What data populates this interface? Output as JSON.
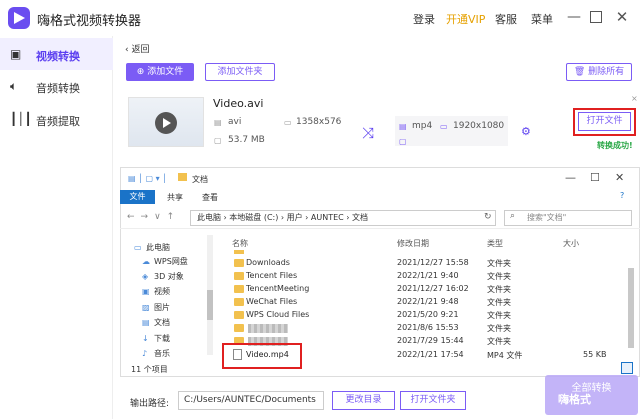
{
  "app": {
    "title": "嗨格式视频转换器"
  },
  "header": {
    "login": "登录",
    "vip": "开通VIP",
    "service": "客服",
    "menu": "菜单"
  },
  "sidebar": {
    "items": [
      {
        "label": "视频转换"
      },
      {
        "label": "音频转换"
      },
      {
        "label": "音频提取"
      }
    ]
  },
  "toolbar": {
    "back": "返回",
    "add_file": "⊕ 添加文件",
    "add_folder": "添加文件夹",
    "delete_all": "删除所有"
  },
  "file": {
    "name": "Video.avi",
    "src_format": "avi",
    "src_resolution": "1358x576",
    "src_size": "53.7 MB",
    "out_format": "mp4",
    "out_resolution": "1920x1080",
    "open_folder": "打开文件",
    "status": "转换成功!"
  },
  "explorer": {
    "title": "文档",
    "ribbon": {
      "file": "文件",
      "share": "共享",
      "view": "查看"
    },
    "address": "此电脑 › 本地磁盘 (C:) › 用户 › AUNTEC › 文档",
    "search_placeholder": "搜索\"文档\"",
    "nav": [
      {
        "label": "此电脑"
      },
      {
        "label": "WPS网盘"
      },
      {
        "label": "3D 对象"
      },
      {
        "label": "视频"
      },
      {
        "label": "图片"
      },
      {
        "label": "文档"
      },
      {
        "label": "下载"
      },
      {
        "label": "音乐"
      }
    ],
    "columns": {
      "name": "名称",
      "modified": "修改日期",
      "type": "类型",
      "size": "大小"
    },
    "rows": [
      {
        "name": "Downloads",
        "modified": "2021/12/27 15:58",
        "type": "文件夹",
        "size": ""
      },
      {
        "name": "Tencent Files",
        "modified": "2022/1/21 9:40",
        "type": "文件夹",
        "size": ""
      },
      {
        "name": "TencentMeeting",
        "modified": "2021/12/27 16:02",
        "type": "文件夹",
        "size": ""
      },
      {
        "name": "WeChat Files",
        "modified": "2022/1/21 9:48",
        "type": "文件夹",
        "size": ""
      },
      {
        "name": "WPS Cloud Files",
        "modified": "2021/5/20 9:21",
        "type": "文件夹",
        "size": ""
      },
      {
        "name": "",
        "modified": "2021/8/6 15:53",
        "type": "文件夹",
        "size": ""
      },
      {
        "name": "",
        "modified": "2021/7/29 15:44",
        "type": "文件夹",
        "size": ""
      }
    ],
    "video_file": {
      "name": "Video.mp4",
      "modified": "2022/1/21 17:54",
      "type": "MP4 文件",
      "size": "55 KB"
    },
    "count": "11 个项目"
  },
  "bottom": {
    "output_label": "输出路径:",
    "output_path": "C:/Users/AUNTEC/Documents",
    "change_dir": "更改目录",
    "open_folder": "打开文件夹",
    "convert_all": "全部转换",
    "watermark": "嗨格式"
  }
}
